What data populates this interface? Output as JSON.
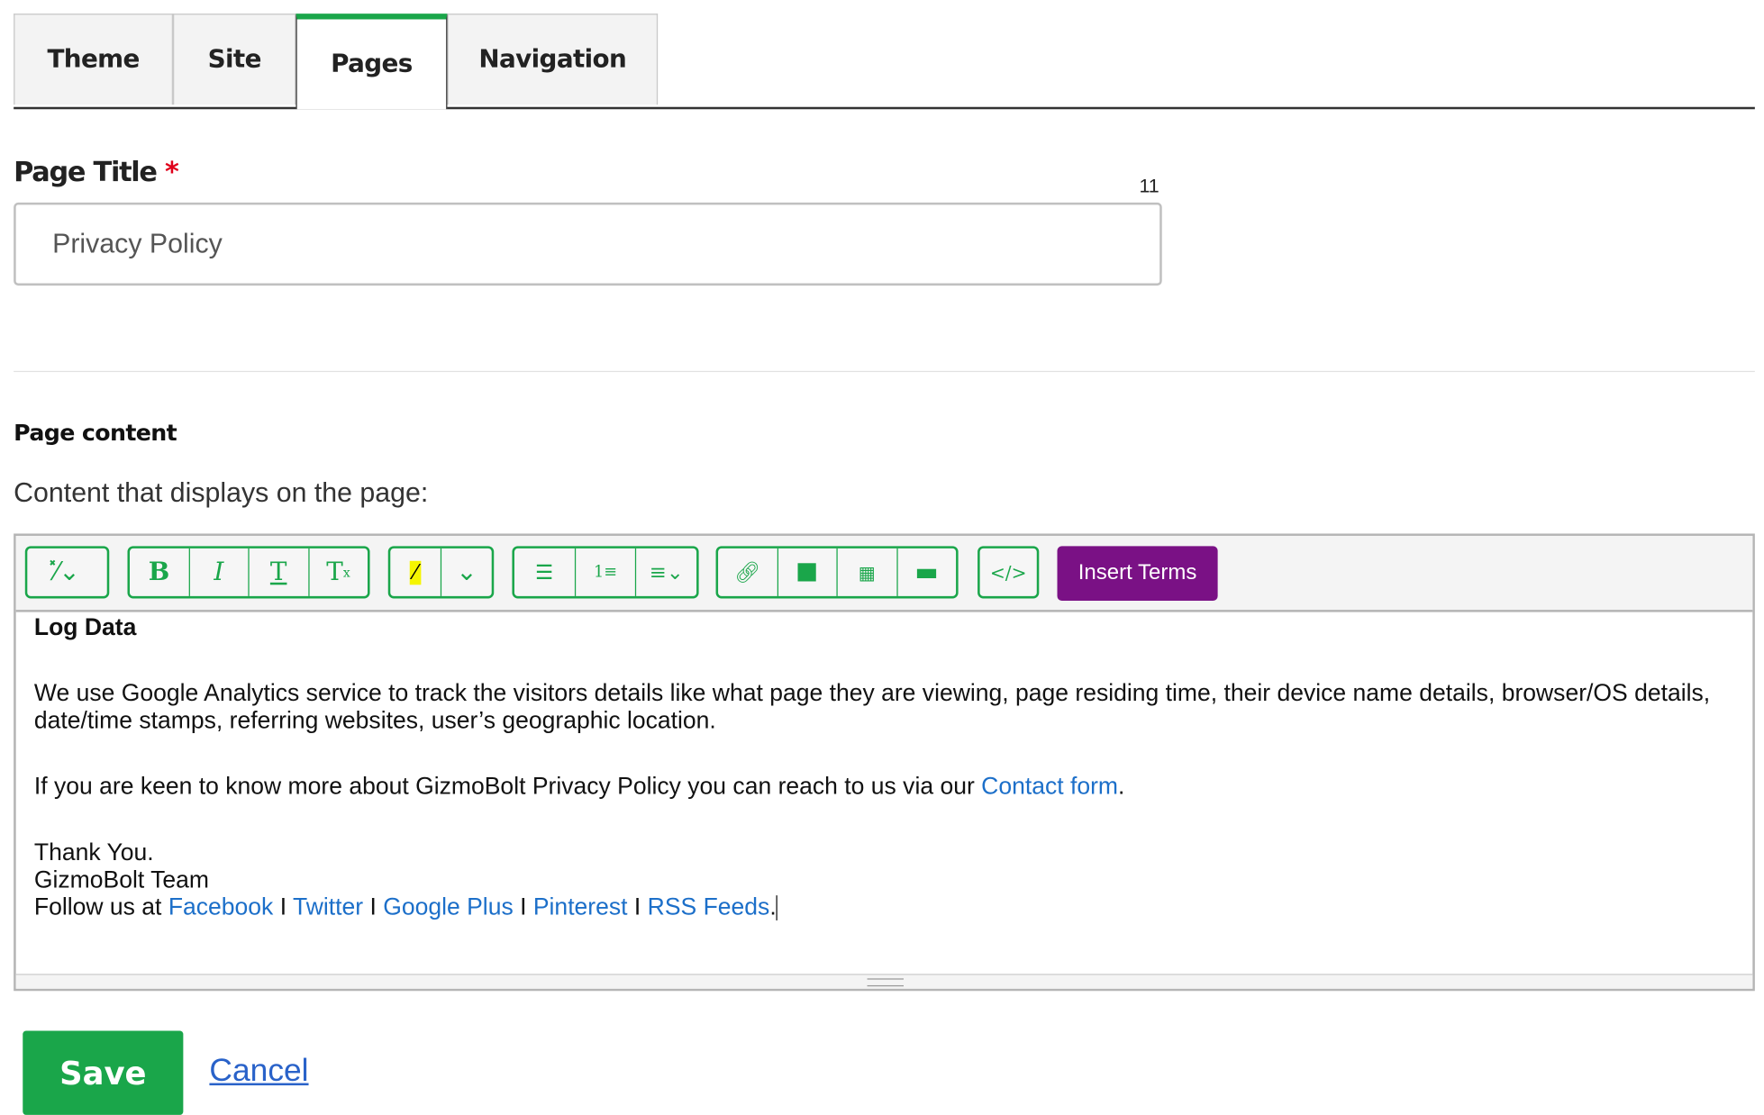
{
  "tabs": [
    {
      "label": "Theme"
    },
    {
      "label": "Site"
    },
    {
      "label": "Pages",
      "active": true
    },
    {
      "label": "Navigation"
    }
  ],
  "page_title": {
    "label": "Page Title",
    "required_mark": "*",
    "char_count": "11",
    "value": "Privacy Policy"
  },
  "page_content": {
    "heading": "Page content",
    "description": "Content that displays on the page:"
  },
  "toolbar": {
    "insert_terms_label": "Insert Terms",
    "icons": [
      "magic-wand",
      "bold",
      "italic",
      "underline-text",
      "clear-format",
      "highlight-color",
      "dropdown",
      "bullet-list",
      "numbered-list",
      "align",
      "link",
      "image",
      "video",
      "horizontal-rule",
      "source-code"
    ]
  },
  "content": {
    "heading": "Log Data",
    "para1": "We use Google Analytics service to track the visitors details like what page they are viewing, page residing time, their device name details, browser/OS details, date/time stamps, referring websites, user’s geographic location.",
    "para2_before": "If you are keen to know more about GizmoBolt Privacy Policy you can reach to us via our ",
    "para2_link": "Contact form",
    "para2_after": ".",
    "thanks": "Thank You.",
    "team": "GizmoBolt Team",
    "follow": "Follow us at ",
    "sep": " I ",
    "links": [
      "Facebook",
      "Twitter",
      "Google Plus",
      "Pinterest",
      "RSS Feeds"
    ],
    "end": "."
  },
  "actions": {
    "save": "Save",
    "cancel": "Cancel"
  },
  "colors": {
    "accent": "#1aa64a",
    "insert_terms": "#7a1185",
    "link": "#1c6fc9"
  }
}
